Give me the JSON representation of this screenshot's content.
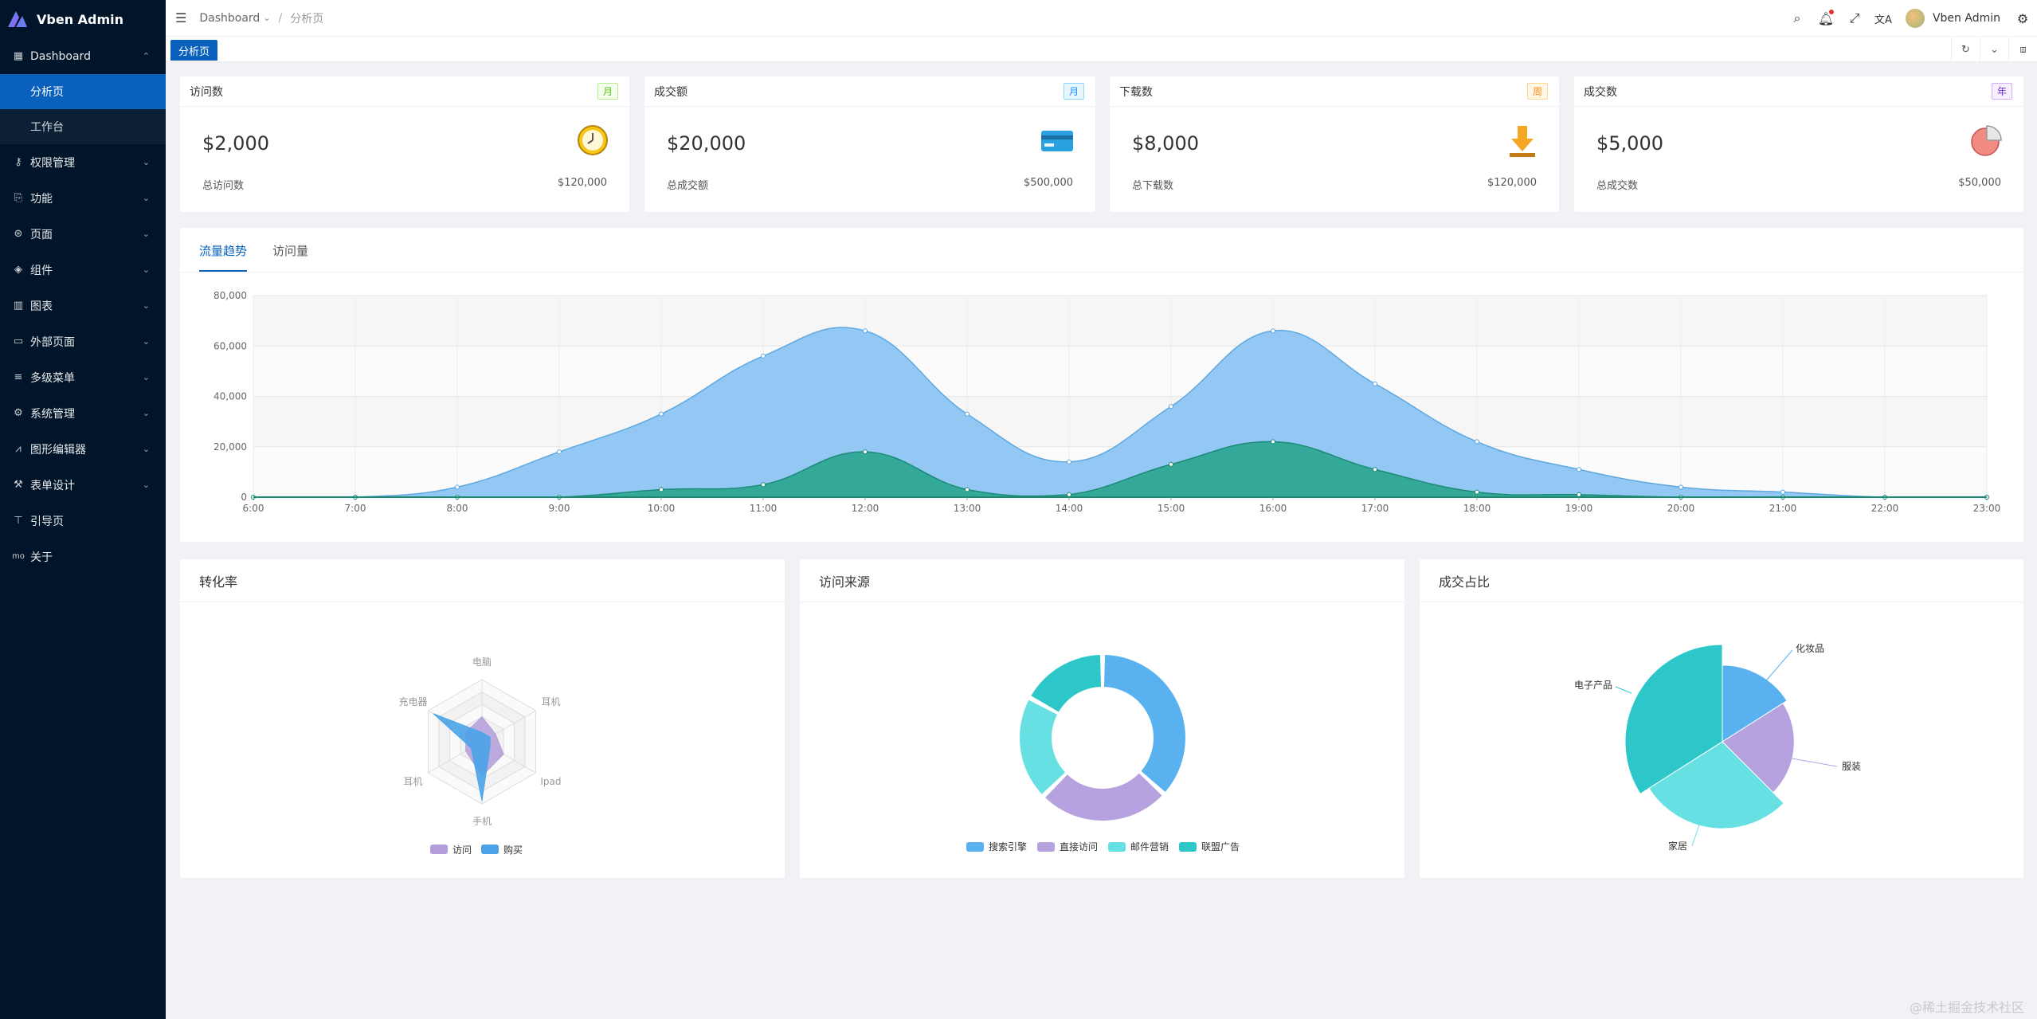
{
  "app": {
    "title": "Vben Admin"
  },
  "sidebar": {
    "dashboard": {
      "label": "Dashboard",
      "icon": "dashboard-icon"
    },
    "sub_items": [
      {
        "label": "分析页",
        "active": true
      },
      {
        "label": "工作台",
        "active": false
      }
    ],
    "items": [
      {
        "label": "权限管理",
        "icon": "key-icon"
      },
      {
        "label": "功能",
        "icon": "function-icon"
      },
      {
        "label": "页面",
        "icon": "page-icon"
      },
      {
        "label": "组件",
        "icon": "layers-icon"
      },
      {
        "label": "图表",
        "icon": "bar-chart-icon"
      },
      {
        "label": "外部页面",
        "icon": "monitor-icon"
      },
      {
        "label": "多级菜单",
        "icon": "menu-icon"
      },
      {
        "label": "系统管理",
        "icon": "settings-icon"
      },
      {
        "label": "图形编辑器",
        "icon": "line-chart-icon"
      },
      {
        "label": "表单设计",
        "icon": "tool-icon"
      },
      {
        "label": "引导页",
        "icon": "paint-roller-icon"
      },
      {
        "label": "关于",
        "icon": "mo-icon"
      }
    ]
  },
  "header": {
    "breadcrumb": [
      "Dashboard",
      "分析页"
    ],
    "user_name": "Vben Admin"
  },
  "tabs": {
    "active": "分析页"
  },
  "stat_cards": [
    {
      "title": "访问数",
      "tag": "月",
      "tag_color": "green",
      "value": "$2,000",
      "icon": "clock-icon",
      "foot_label": "总访问数",
      "foot_value": "$120,000"
    },
    {
      "title": "成交额",
      "tag": "月",
      "tag_color": "blue",
      "value": "$20,000",
      "icon": "credit-card-icon",
      "foot_label": "总成交额",
      "foot_value": "$500,000"
    },
    {
      "title": "下载数",
      "tag": "周",
      "tag_color": "orange",
      "value": "$8,000",
      "icon": "download-icon",
      "foot_label": "总下载数",
      "foot_value": "$120,000"
    },
    {
      "title": "成交数",
      "tag": "年",
      "tag_color": "purple",
      "value": "$5,000",
      "icon": "pie-icon",
      "foot_label": "总成交数",
      "foot_value": "$50,000"
    }
  ],
  "trend": {
    "tabs": [
      "流量趋势",
      "访问量"
    ],
    "active_tab": 0
  },
  "bottom_cards": [
    {
      "title": "转化率"
    },
    {
      "title": "访问来源"
    },
    {
      "title": "成交占比"
    }
  ],
  "watermark": "@稀土掘金技术社区",
  "colors": {
    "sidebar": "#001529",
    "accent": "#0960bd",
    "area1": "#7dbcee",
    "area2": "#1b9e8a"
  },
  "chart_data": [
    {
      "type": "area",
      "x": [
        "6:00",
        "7:00",
        "8:00",
        "9:00",
        "10:00",
        "11:00",
        "12:00",
        "13:00",
        "14:00",
        "15:00",
        "16:00",
        "17:00",
        "18:00",
        "19:00",
        "20:00",
        "21:00",
        "22:00",
        "23:00"
      ],
      "series": [
        {
          "values": [
            0,
            0,
            4000,
            18000,
            33000,
            56000,
            66000,
            33000,
            14000,
            36000,
            66000,
            45000,
            22000,
            11000,
            4000,
            2000,
            0,
            0
          ]
        },
        {
          "values": [
            0,
            0,
            0,
            0,
            3000,
            5000,
            18000,
            3000,
            1000,
            13000,
            22000,
            11000,
            2000,
            1000,
            0,
            0,
            0,
            0
          ]
        }
      ],
      "yticks": [
        "0",
        "20,000",
        "40,000",
        "60,000",
        "80,000"
      ],
      "ylim": [
        0,
        80000
      ],
      "grid": true
    },
    {
      "type": "radar",
      "indicators": [
        "电脑",
        "耳机",
        "Ipad",
        "手机",
        "耳机",
        "充电器"
      ],
      "series": [
        {
          "name": "访问",
          "values": [
            40,
            25,
            40,
            55,
            30,
            30
          ]
        },
        {
          "name": "购买",
          "values": [
            15,
            15,
            15,
            95,
            20,
            90
          ]
        }
      ],
      "max": 100,
      "legend": "bottom"
    },
    {
      "type": "pie",
      "donut": true,
      "categories": [
        "搜索引擎",
        "直接访问",
        "邮件营销",
        "联盟广告"
      ],
      "values": [
        1048,
        735,
        580,
        484
      ],
      "legend": "bottom"
    },
    {
      "type": "pie",
      "rose": true,
      "categories": [
        "电子产品",
        "化妆品",
        "服装",
        "家居"
      ],
      "values": [
        500,
        310,
        274,
        400
      ]
    }
  ]
}
